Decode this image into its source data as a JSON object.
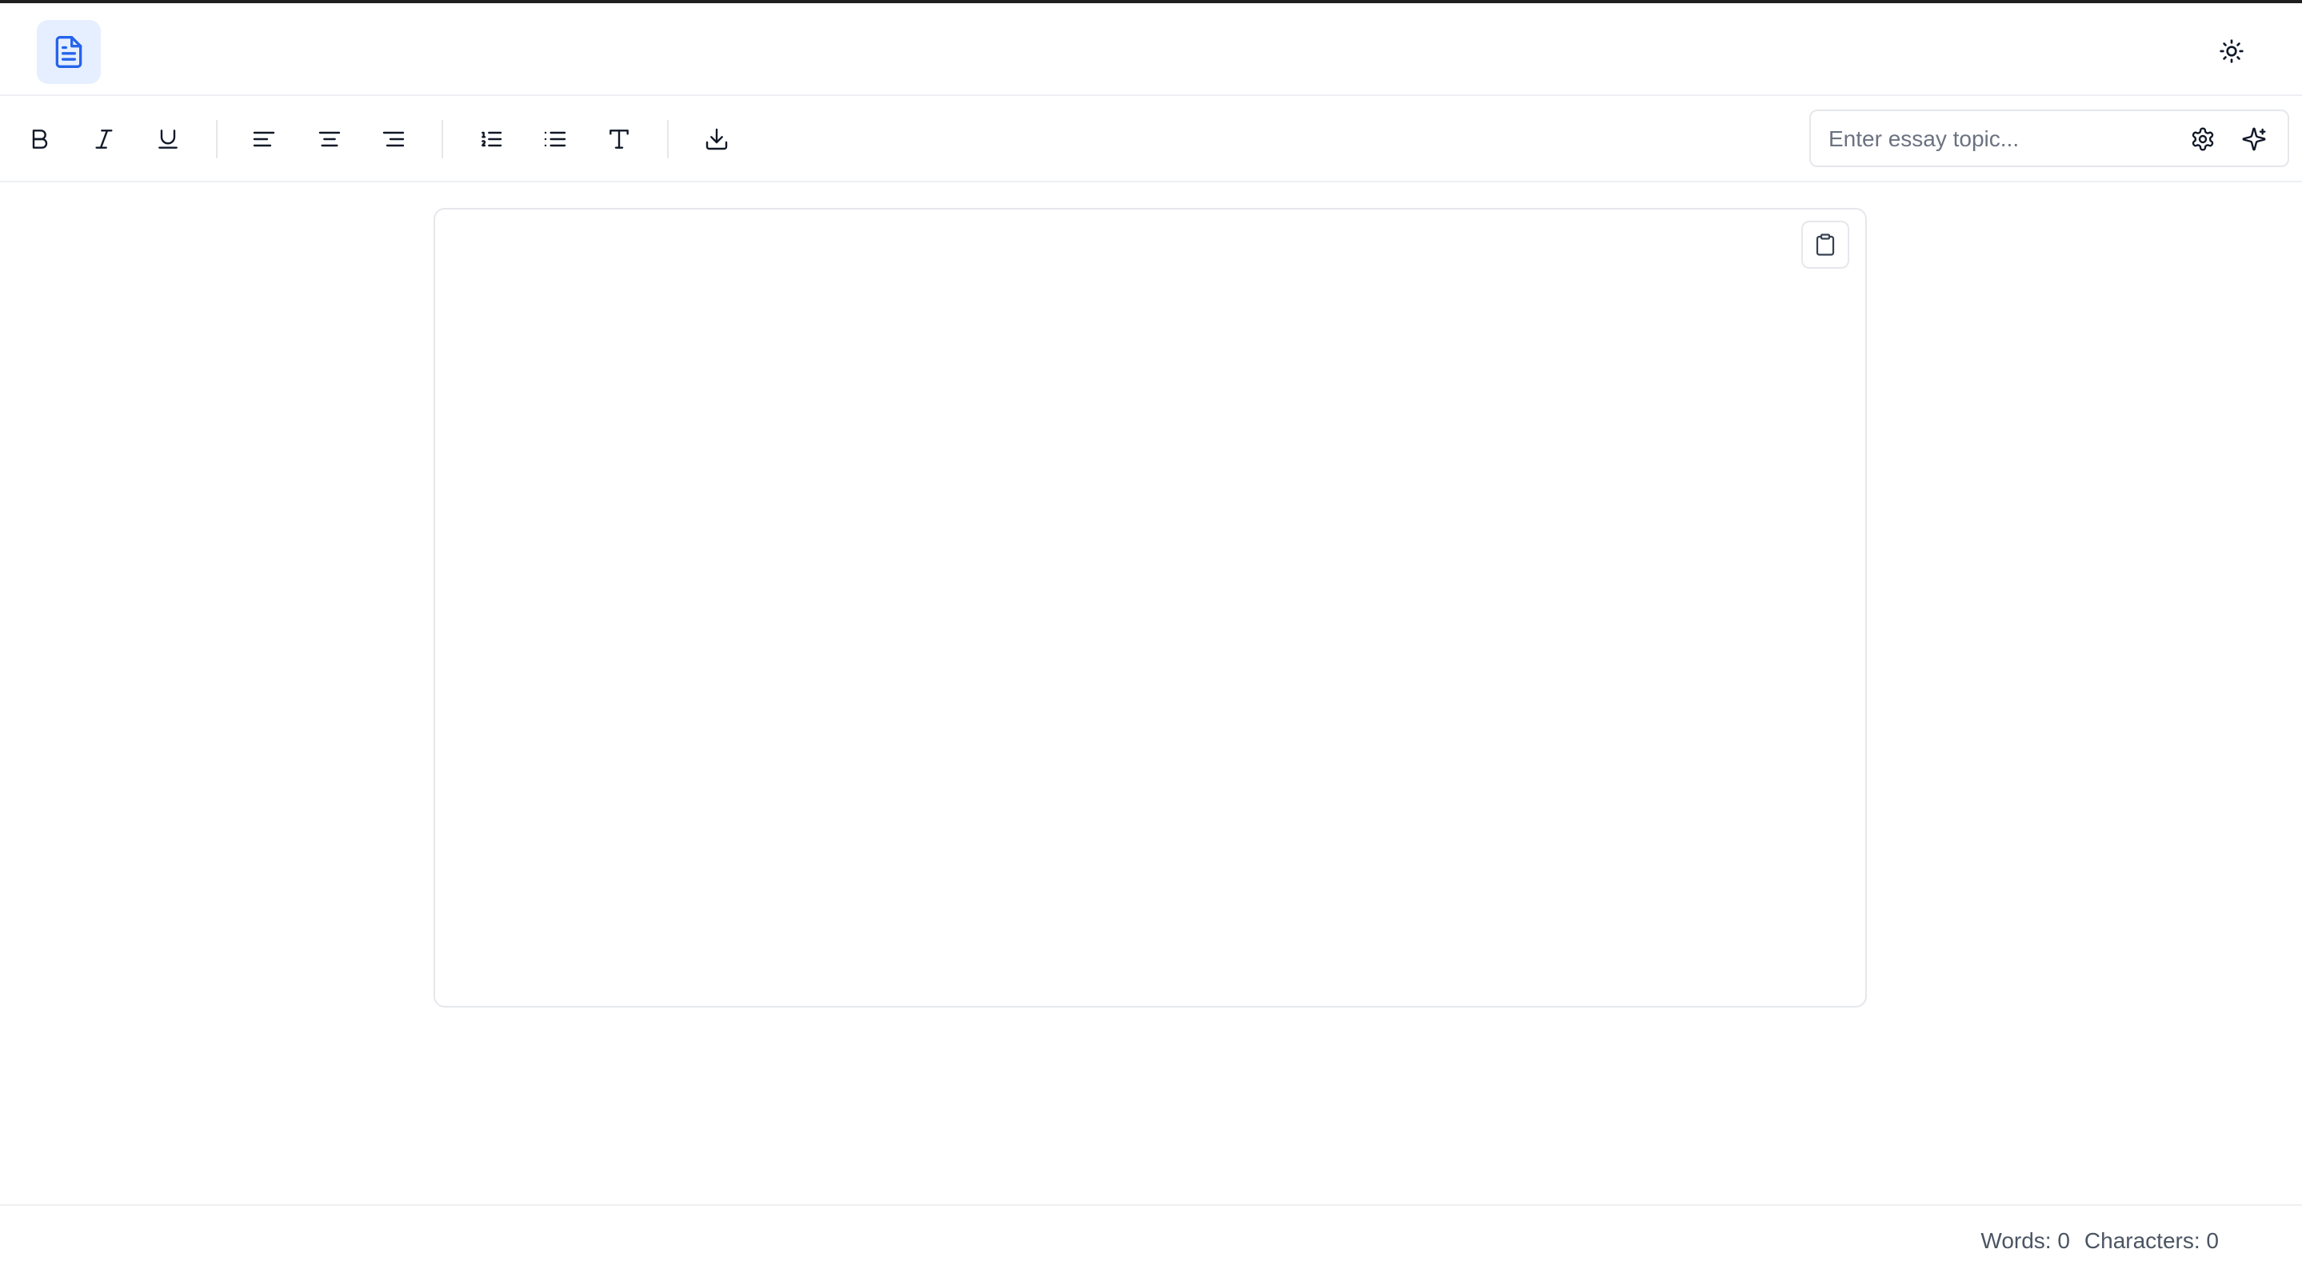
{
  "header": {
    "logo_icon": "file-text-icon",
    "theme_icon": "sun-icon"
  },
  "toolbar": {
    "buttons": [
      {
        "name": "bold-button",
        "icon": "bold-icon"
      },
      {
        "name": "italic-button",
        "icon": "italic-icon"
      },
      {
        "name": "underline-button",
        "icon": "underline-icon"
      },
      {
        "name": "align-left-button",
        "icon": "align-left-icon"
      },
      {
        "name": "align-center-button",
        "icon": "align-center-icon"
      },
      {
        "name": "align-right-button",
        "icon": "align-right-icon"
      },
      {
        "name": "ordered-list-button",
        "icon": "list-ordered-icon"
      },
      {
        "name": "bullet-list-button",
        "icon": "list-icon"
      },
      {
        "name": "text-style-button",
        "icon": "type-icon"
      },
      {
        "name": "download-button",
        "icon": "download-icon"
      }
    ],
    "topic": {
      "placeholder": "Enter essay topic...",
      "value": "",
      "settings_icon": "gear-icon",
      "generate_icon": "sparkles-icon"
    }
  },
  "editor": {
    "content": "",
    "copy_icon": "clipboard-icon"
  },
  "footer": {
    "words_label": "Words: 0",
    "characters_label": "Characters: 0"
  },
  "colors": {
    "accent": "#2563eb",
    "logo_bg": "#e6efff",
    "border": "#e5e7eb",
    "muted_text": "#4b5563"
  }
}
